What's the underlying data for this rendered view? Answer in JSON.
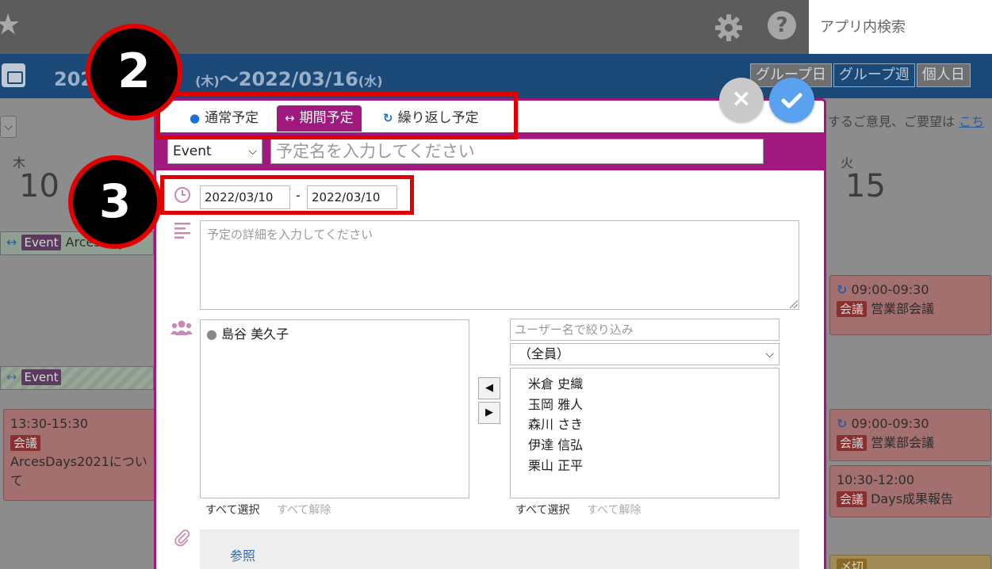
{
  "topbar": {
    "search_placeholder": "アプリ内検索",
    "help_label": "?"
  },
  "header": {
    "range_start": "202",
    "range_start_dow": "(木)",
    "range_separator": "〜",
    "range_end": "2022/03/16",
    "range_end_dow": "(水)",
    "view_tabs": [
      "グループ日",
      "グループ週",
      "個人日"
    ]
  },
  "background": {
    "dropdown_glyph": "⌵",
    "feedback_text": "するご意見、ご要望は",
    "feedback_link": "こち",
    "day_left": {
      "dow": "木",
      "num": "10"
    },
    "day_right": {
      "dow": "火",
      "num": "15"
    },
    "events_left": [
      {
        "badge": "Event",
        "text": "ArcesDays"
      },
      {
        "badge": "Event",
        "text": ""
      }
    ],
    "card_left": {
      "time": "13:30-15:30",
      "badge": "会議",
      "title": "ArcesDays2021につい",
      "title2": "て"
    },
    "cards_right": [
      {
        "time": "09:00-09:30",
        "badge": "会議",
        "title": "営業部会議"
      },
      {
        "time": "09:00-09:30",
        "badge": "会議",
        "title": "営業部会議"
      },
      {
        "time": "10:30-12:00",
        "badge": "会議",
        "title": "Days成果報告"
      },
      {
        "time": "",
        "badge": "〆切",
        "title": ""
      }
    ]
  },
  "modal": {
    "tabs": [
      {
        "label": "通常予定",
        "active": false
      },
      {
        "label": "期間予定",
        "active": true
      },
      {
        "label": "繰り返し予定",
        "active": false
      }
    ],
    "type_select": "Event",
    "title_placeholder": "予定名を入力してください",
    "date_from": "2022/03/10",
    "date_sep": "-",
    "date_to": "2022/03/10",
    "detail_placeholder": "予定の詳細を入力してください",
    "members": [
      "島谷 美久子"
    ],
    "filter_placeholder": "ユーザー名で絞り込み",
    "group_select": "（全員）",
    "candidates": [
      "米倉 史織",
      "玉岡 雅人",
      "森川 さき",
      "伊達 信弘",
      "栗山 正平"
    ],
    "select_all": "すべて選択",
    "deselect_all": "すべて解除",
    "attach_button": "参照"
  },
  "annotations": {
    "callout_tabs": "2",
    "callout_dates": "3"
  },
  "colors": {
    "accent": "#a0197e",
    "annotation": "#e00000",
    "ok_button": "#5aa2f0",
    "header": "#1c4a78"
  }
}
